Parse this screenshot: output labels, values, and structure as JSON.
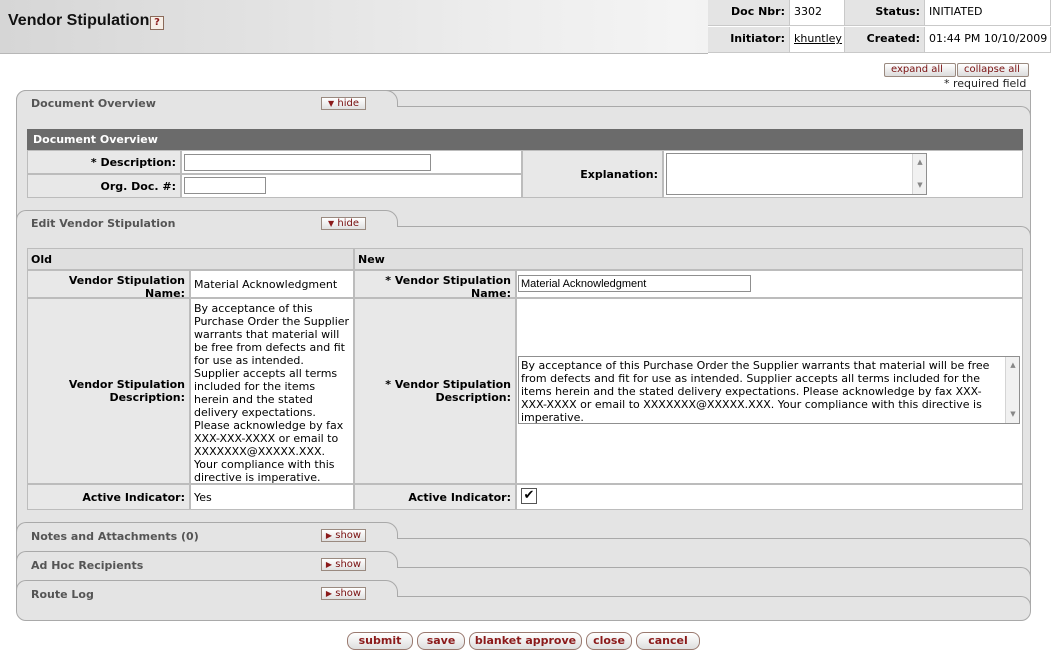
{
  "header": {
    "title": "Vendor Stipulation",
    "help_glyph": "?",
    "doc_nbr_label": "Doc Nbr:",
    "doc_nbr": "3302",
    "status_label": "Status:",
    "status": "INITIATED",
    "initiator_label": "Initiator:",
    "initiator": "khuntley",
    "created_label": "Created:",
    "created": "01:44 PM 10/10/2009"
  },
  "controls": {
    "expand_all": "expand all",
    "collapse_all": "collapse all",
    "required_note": "* required field"
  },
  "tabs": {
    "doc_overview": {
      "title": "Document Overview",
      "button": "hide"
    },
    "edit": {
      "title": "Edit Vendor Stipulation",
      "button": "hide"
    },
    "notes": {
      "title": "Notes and Attachments (0)",
      "button": "show"
    },
    "adhoc": {
      "title": "Ad Hoc Recipients",
      "button": "show"
    },
    "route": {
      "title": "Route Log",
      "button": "show"
    }
  },
  "doc_overview": {
    "section_title": "Document Overview",
    "description_label": "* Description:",
    "description_value": "",
    "org_doc_label": "Org. Doc. #:",
    "org_doc_value": "",
    "explanation_label": "Explanation:",
    "explanation_value": ""
  },
  "edit": {
    "old_header": "Old",
    "new_header": "New",
    "name_label_1": "Vendor Stipulation",
    "name_label_2": "Name:",
    "req_name_label_1": "*  Vendor Stipulation",
    "old_name": "Material Acknowledgment",
    "new_name": "Material Acknowledgment",
    "desc_label_1": "Vendor Stipulation",
    "desc_label_2": "Description:",
    "req_desc_label_1": "*  Vendor Stipulation",
    "old_description": "By acceptance of this Purchase Order the Supplier warrants that material will be free from defects and fit for use as intended. Supplier accepts all terms included for the items herein and the stated delivery expectations. Please acknowledge by fax XXX-XXX-XXXX or email to XXXXXXX@XXXXX.XXX. Your compliance with this directive is imperative.",
    "new_description": "By acceptance of this Purchase Order the Supplier warrants that material will be free from defects and fit for use as intended. Supplier accepts all terms included for the items herein and the stated delivery expectations. Please acknowledge by fax XXX-XXX-XXXX or email to XXXXXXX@XXXXX.XXX. Your compliance with this directive is imperative.",
    "active_label": "Active Indicator:",
    "old_active": "Yes",
    "new_active_checked": true,
    "check_glyph": "✔"
  },
  "actions": {
    "submit": "submit",
    "save": "save",
    "blanket_approve": "blanket approve",
    "close": "close",
    "cancel": "cancel"
  }
}
